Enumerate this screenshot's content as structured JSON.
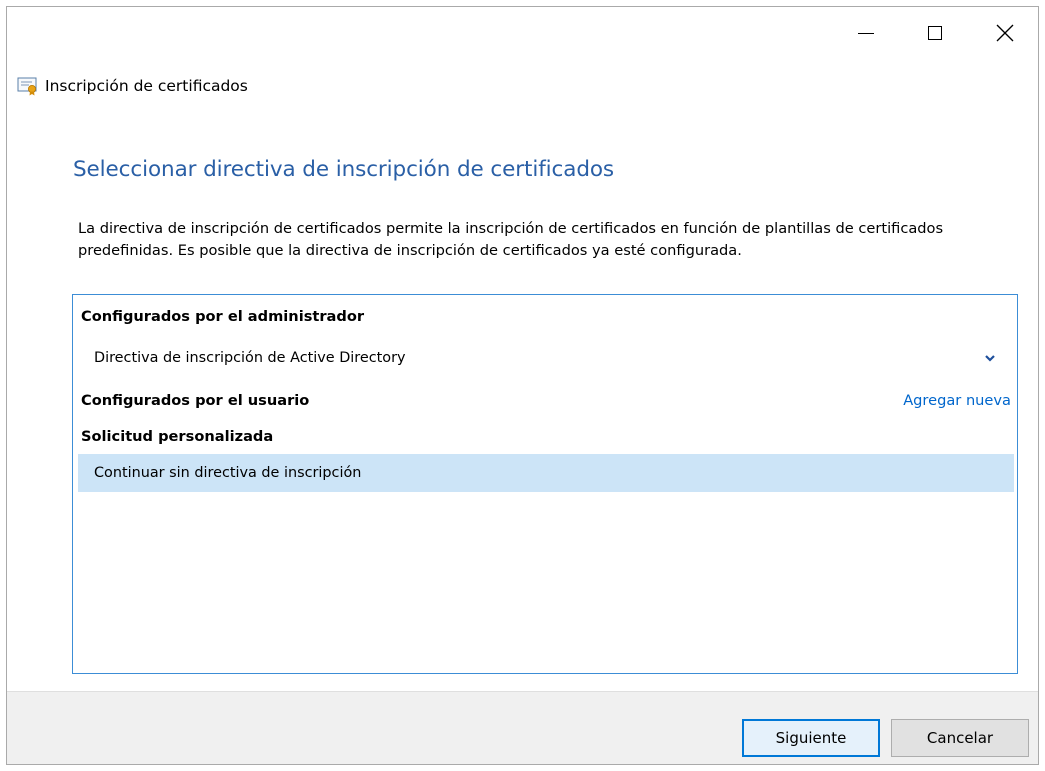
{
  "window": {
    "title": "Inscripción de certificados",
    "controls": {
      "minimize": "minimize-icon",
      "maximize": "maximize-icon",
      "close": "close-icon"
    }
  },
  "page": {
    "heading": "Seleccionar directiva de inscripción de certificados",
    "description": "La directiva de inscripción de certificados permite la inscripción de certificados en función de plantillas de certificados predefinidas. Es posible que la directiva de inscripción de certificados ya esté configurada."
  },
  "policies": {
    "admin_group": "Configurados por el administrador",
    "admin_item": "Directiva de inscripción de Active Directory",
    "user_group": "Configurados por el usuario",
    "add_new": "Agregar nueva",
    "custom_group": "Solicitud personalizada",
    "custom_item": "Continuar sin directiva de inscripción"
  },
  "footer": {
    "next_label": "Siguiente",
    "cancel_label": "Cancelar"
  },
  "colors": {
    "heading": "#2a5fa6",
    "link": "#0066cc",
    "selection": "#cce4f7",
    "box_border": "#3c8dd6",
    "footer_bg": "#f0f0f0",
    "default_button_border": "#0078d7"
  }
}
